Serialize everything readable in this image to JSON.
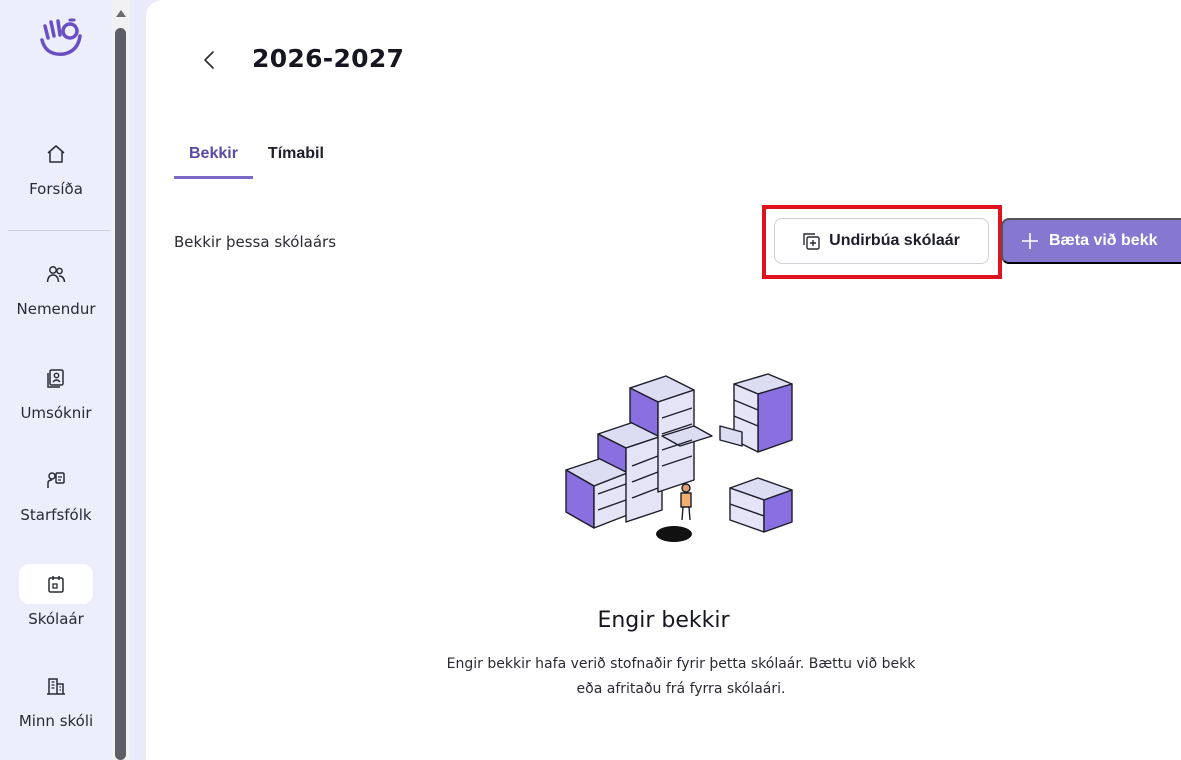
{
  "sidebar": {
    "logo_icon": "wave-logo-icon",
    "items": [
      {
        "label": "Forsíða",
        "icon": "home-icon",
        "active": false
      },
      {
        "label": "Nemendur",
        "icon": "users-icon",
        "active": false
      },
      {
        "label": "Umsóknir",
        "icon": "application-form-icon",
        "active": false
      },
      {
        "label": "Starfsfólk",
        "icon": "staff-badge-icon",
        "active": false
      },
      {
        "label": "Skólaár",
        "icon": "calendar-icon",
        "active": true
      },
      {
        "label": "Minn skóli",
        "icon": "building-icon",
        "active": false
      }
    ]
  },
  "header": {
    "back_icon": "chevron-left-icon",
    "title": "2026-2027"
  },
  "tabs": [
    {
      "label": "Bekkir",
      "active": true
    },
    {
      "label": "Tímabil",
      "active": false
    }
  ],
  "section": {
    "label": "Bekkir þessa skólaárs"
  },
  "actions": {
    "prepare_label": "Undirbúa skólaár",
    "prepare_icon": "copy-plus-icon",
    "add_label": "Bæta við bekk",
    "add_icon": "plus-icon"
  },
  "empty_state": {
    "illustration": "file-cabinets-illustration",
    "title": "Engir bekkir",
    "text": "Engir bekkir hafa verið stofnaðir fyrir þetta skólaár. Bættu við bekk eða afritaðu frá fyrra skólaári."
  },
  "colors": {
    "accent": "#8677d0",
    "tab_active": "#5b4aa3",
    "sidebar_bg": "#eceefb",
    "highlight": "#e0121e"
  }
}
